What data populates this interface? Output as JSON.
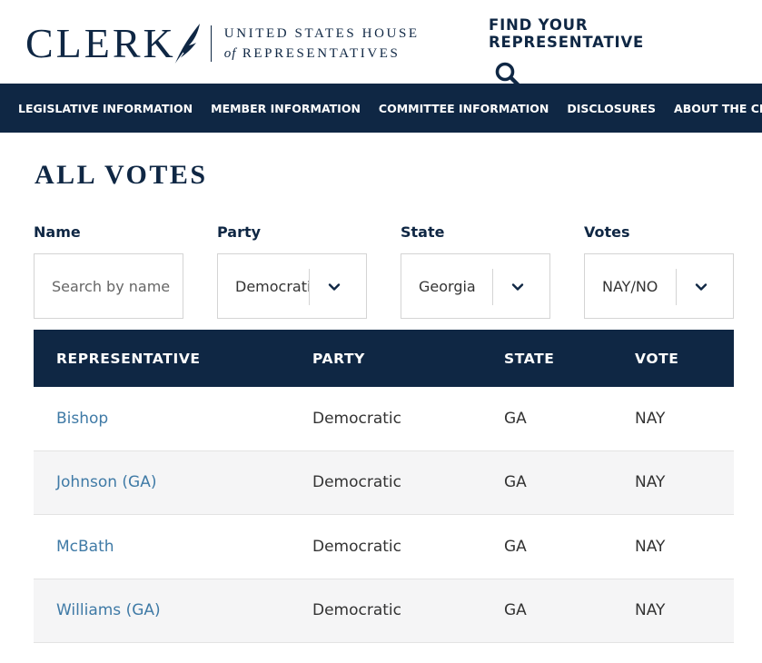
{
  "header": {
    "logo_word": "CLERK",
    "logo_line1": "UNITED STATES HOUSE",
    "logo_of": "of",
    "logo_line2": "REPRESENTATIVES",
    "find_title": "FIND YOUR REPRESENTATIVE",
    "search_icon": "search-icon"
  },
  "nav": {
    "items": [
      "LEGISLATIVE INFORMATION",
      "MEMBER INFORMATION",
      "COMMITTEE INFORMATION",
      "DISCLOSURES",
      "ABOUT THE CLERK"
    ]
  },
  "page": {
    "title": "ALL VOTES"
  },
  "filters": {
    "name": {
      "label": "Name",
      "placeholder": "Search by name"
    },
    "party": {
      "label": "Party",
      "value": "Democratic"
    },
    "state": {
      "label": "State",
      "value": "Georgia"
    },
    "votes": {
      "label": "Votes",
      "value": "NAY/NO"
    }
  },
  "table": {
    "columns": [
      "REPRESENTATIVE",
      "PARTY",
      "STATE",
      "VOTE"
    ],
    "rows": [
      {
        "representative": "Bishop",
        "party": "Democratic",
        "state": "GA",
        "vote": "NAY"
      },
      {
        "representative": "Johnson (GA)",
        "party": "Democratic",
        "state": "GA",
        "vote": "NAY"
      },
      {
        "representative": "McBath",
        "party": "Democratic",
        "state": "GA",
        "vote": "NAY"
      },
      {
        "representative": "Williams (GA)",
        "party": "Democratic",
        "state": "GA",
        "vote": "NAY"
      }
    ]
  },
  "colors": {
    "navy": "#0f2744",
    "link": "#3f7aa6",
    "row_alt": "#f5f5f6"
  }
}
